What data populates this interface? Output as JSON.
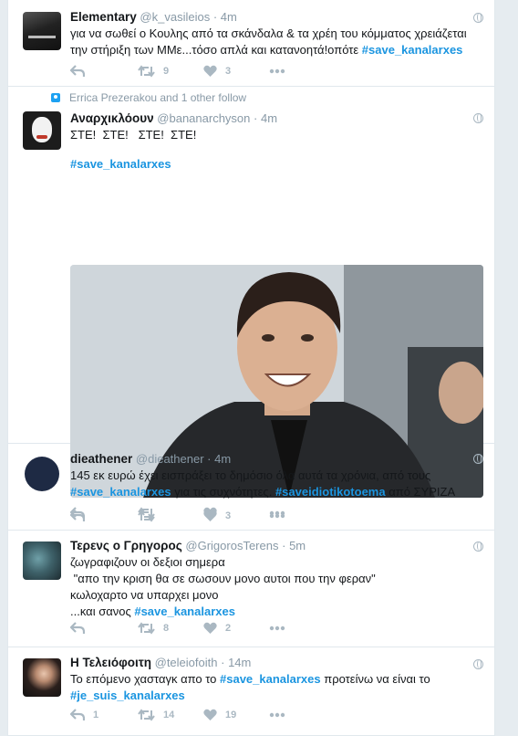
{
  "tweets": [
    {
      "fullname": "Elementary",
      "username": "@k_vasileios",
      "time": "4m",
      "text_1": "για να σωθεί ο Κουλης από τα σκάνδαλα & τα χρέη του κόμματος χρειάζεται την στήριξη των ΜΜε...τόσο απλά και κατανοητά!οπότε ",
      "hashtag_1": "#save_kanalarxes",
      "retweets": "9",
      "likes": "3"
    },
    {
      "context": "Errica Prezerakou and 1 other follow",
      "fullname": "Αναρχικλόουν",
      "username": "@bananarchyson",
      "time": "4m",
      "text_1": "ΣΤΕ!  ΣΤΕ!   ΣΤΕ!  ΣΤΕ!",
      "hashtag_1": "#save_kanalarxes",
      "retweets": "",
      "likes": "3"
    },
    {
      "fullname": "dieathener",
      "username": "@dieathener",
      "time": "4m",
      "text_1": "145 εκ ευρώ έχει εισπράξει το δημόσιο όλα αυτά τα χρόνια, από τους ",
      "hashtag_1": "#save_kanalarxes",
      "text_2": " για τις συχνότητες. ",
      "hashtag_2": "#saveidiotikotoema",
      "text_3": " από ΣΥΡΙΖΑ",
      "retweets": "",
      "likes": ""
    },
    {
      "fullname": "Τερενς ο Γρηγορος",
      "username": "@GrigorosTerens",
      "time": "5m",
      "line_1": "ζωγραφιζουν οι δεξιοι σημερα",
      "line_2": " \"απο την κριση θα σε σωσουν μονο αυτοι που την φεραν\"",
      "line_3": "κωλοχαρτο να υπαρχει μονο",
      "line_4": "...και σανος ",
      "hashtag_1": "#save_kanalarxes",
      "retweets": "8",
      "likes": "2"
    },
    {
      "fullname": "Η Τελειόφοιτη",
      "username": "@teleiofoith",
      "time": "14m",
      "text_1": "Το επόμενο χασταγκ απο το ",
      "hashtag_1": "#save_kanalarxes",
      "text_2": " προτείνω να είναι το ",
      "hashtag_2": "#je_suis_kanalarxes",
      "replies": "1",
      "retweets": "14",
      "likes": "19"
    }
  ],
  "dot": "·",
  "colors": {
    "link": "#1b95e0",
    "muted": "#8899a6",
    "icon": "#aab8c2",
    "border": "#e1e8ed"
  }
}
